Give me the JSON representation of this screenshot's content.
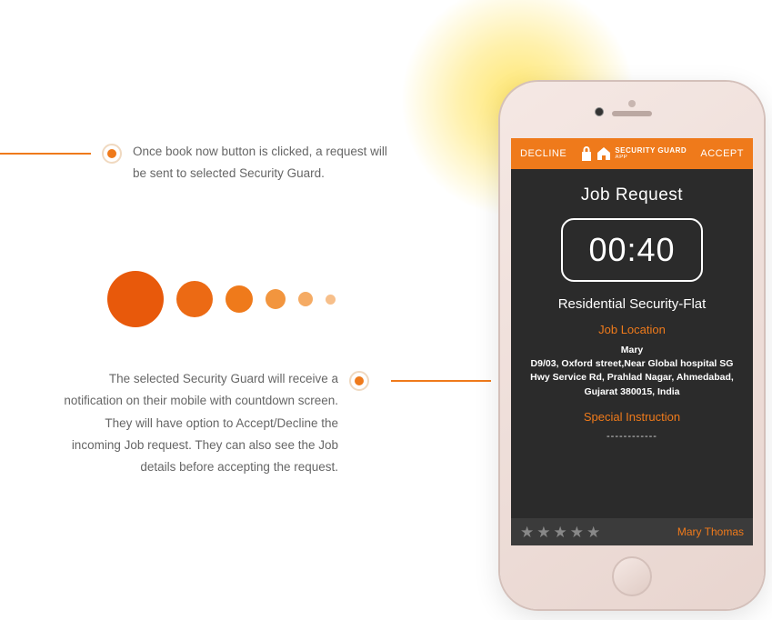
{
  "callouts": {
    "top": "Once book now button is clicked, a request will be sent to selected Security Guard.",
    "bottom": "The selected Security Guard will receive a notification on their mobile with countdown screen. They will have option to Accept/Decline the incoming Job request. They can also see the Job details before accepting the request."
  },
  "phone": {
    "topbar": {
      "decline": "DECLINE",
      "accept": "ACCEPT",
      "logo_line1": "SECURITY GUARD",
      "logo_line2": "APP"
    },
    "screen": {
      "title": "Job  Request",
      "timer": "00:40",
      "type": "Residential Security-Flat",
      "location_heading": "Job Location",
      "customer_name": "Mary",
      "address": "D9/03, Oxford street,Near Global hospital SG Hwy Service Rd, Prahlad Nagar, Ahmedabad, Gujarat 380015, India",
      "instruction_heading": "Special Instruction",
      "instruction_value": "------------"
    },
    "footer": {
      "rating_count": 5,
      "username": "Mary Thomas"
    }
  }
}
